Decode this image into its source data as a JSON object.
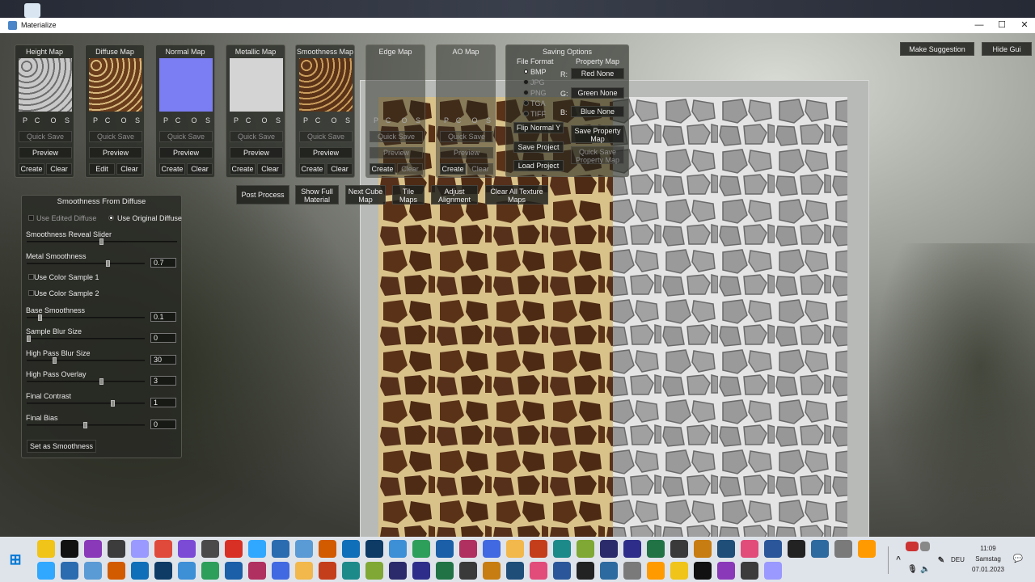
{
  "window": {
    "title": "Materialize",
    "controls": {
      "minimize": "—",
      "maximize": "☐",
      "close": "✕"
    }
  },
  "maps": [
    {
      "title": "Height Map",
      "pcos": [
        "P",
        "C",
        "O",
        "S"
      ],
      "quick_save": "Quick Save",
      "preview": "Preview",
      "left": "Create",
      "right": "Clear"
    },
    {
      "title": "Diffuse Map",
      "pcos": [
        "P",
        "C",
        "O",
        "S"
      ],
      "quick_save": "Quick Save",
      "preview": "Preview",
      "left": "Edit",
      "right": "Clear"
    },
    {
      "title": "Normal Map",
      "pcos": [
        "P",
        "C",
        "O",
        "S"
      ],
      "quick_save": "Quick Save",
      "preview": "Preview",
      "left": "Create",
      "right": "Clear"
    },
    {
      "title": "Metallic Map",
      "pcos": [
        "P",
        "C",
        "O",
        "S"
      ],
      "quick_save": "Quick Save",
      "preview": "Preview",
      "left": "Create",
      "right": "Clear"
    },
    {
      "title": "Smoothness Map",
      "pcos": [
        "P",
        "C",
        "O",
        "S"
      ],
      "quick_save": "Quick Save",
      "preview": "Preview",
      "left": "Create",
      "right": "Clear"
    },
    {
      "title": "Edge Map",
      "pcos": [
        "P",
        "C",
        "O",
        "S"
      ],
      "quick_save": "Quick Save",
      "preview": "Preview",
      "left": "Create",
      "right": "Clear"
    },
    {
      "title": "AO Map",
      "pcos": [
        "P",
        "C",
        "O",
        "S"
      ],
      "quick_save": "Quick Save",
      "preview": "Preview",
      "left": "Create",
      "right": "Clear"
    }
  ],
  "saving": {
    "title": "Saving Options",
    "file_format_label": "File Format",
    "formats": [
      "BMP",
      "JPG",
      "PNG",
      "TGA",
      "TIFF"
    ],
    "selected_format": "BMP",
    "property_map_label": "Property Map",
    "channels": [
      {
        "key": "R:",
        "value": "Red None"
      },
      {
        "key": "G:",
        "value": "Green None"
      },
      {
        "key": "B:",
        "value": "Blue None"
      }
    ],
    "flip_normal": "Flip Normal Y",
    "save_project": "Save Project",
    "load_project": "Load Project",
    "save_property_map": "Save Property Map",
    "quick_save_property_map": "Quick Save Property Map"
  },
  "toolbar": {
    "post_process": "Post Process",
    "show_full_material": "Show Full Material",
    "next_cube_map": "Next Cube Map",
    "tile_maps": "Tile Maps",
    "adjust_alignment": "Adjust Alignment",
    "clear_all": "Clear All Texture Maps"
  },
  "top_right": {
    "make_suggestion": "Make Suggestion",
    "hide_gui": "Hide Gui"
  },
  "smoothness": {
    "title": "Smoothness From Diffuse",
    "use_edited_diffuse": "Use Edited Diffuse",
    "use_original_diffuse": "Use Original Diffuse",
    "reveal_slider_label": "Smoothness Reveal Slider",
    "reveal_value": 0.5,
    "color_sample_1": "Use Color Sample 1",
    "color_sample_2": "Use Color Sample 2",
    "sliders": [
      {
        "label": "Metal Smoothness",
        "value": "0.7",
        "fraction": 0.7
      },
      {
        "label": "Base Smoothness",
        "value": "0.1",
        "fraction": 0.1
      },
      {
        "label": "Sample Blur Size",
        "value": "0",
        "fraction": 0.0
      },
      {
        "label": "High Pass Blur Size",
        "value": "30",
        "fraction": 0.23
      },
      {
        "label": "High Pass Overlay",
        "value": "3",
        "fraction": 0.64
      },
      {
        "label": "Final Contrast",
        "value": "1",
        "fraction": 0.74
      },
      {
        "label": "Final Bias",
        "value": "0",
        "fraction": 0.5
      }
    ],
    "set_button": "Set as Smoothness"
  },
  "taskbar": {
    "apps": [
      "file-explorer",
      "weather",
      "calculator",
      "chrome",
      "folder",
      "word",
      "excel",
      "powerpoint",
      "greenshot",
      "snipping",
      "affinity",
      "inkscape",
      "unity",
      "app-a",
      "app-b",
      "app-c",
      "app-d",
      "app-e",
      "app-f",
      "app-g",
      "app-h",
      "app-i",
      "app-j",
      "app-k",
      "materialize",
      "app-l",
      "app-m",
      "app-n",
      "pse",
      "app-o",
      "app-p",
      "photoshop",
      "premiere",
      "illustrator",
      "app-q",
      "audition"
    ],
    "row2": [
      "kindle",
      "app-r",
      "fresco",
      "dimension",
      "vlc",
      "app-s",
      "app-t",
      "app-u",
      "app-v",
      "app-w",
      "app-x",
      "steam",
      "filezilla",
      "app-y",
      "app-z",
      "app-aa",
      "nzxt",
      "app-bb",
      "unreal",
      "app-cc",
      "app-dd",
      "app-ee",
      "app-ff",
      "acrobat",
      "app-gg",
      "app-hh",
      "camera",
      "app-ii",
      "app-jj",
      "app-kk",
      "winrar",
      "opera"
    ],
    "language": "DEU",
    "time": "11:09",
    "day": "Samstag",
    "date": "07.01.2023",
    "colors": {
      "accent": "#0078d4"
    }
  }
}
